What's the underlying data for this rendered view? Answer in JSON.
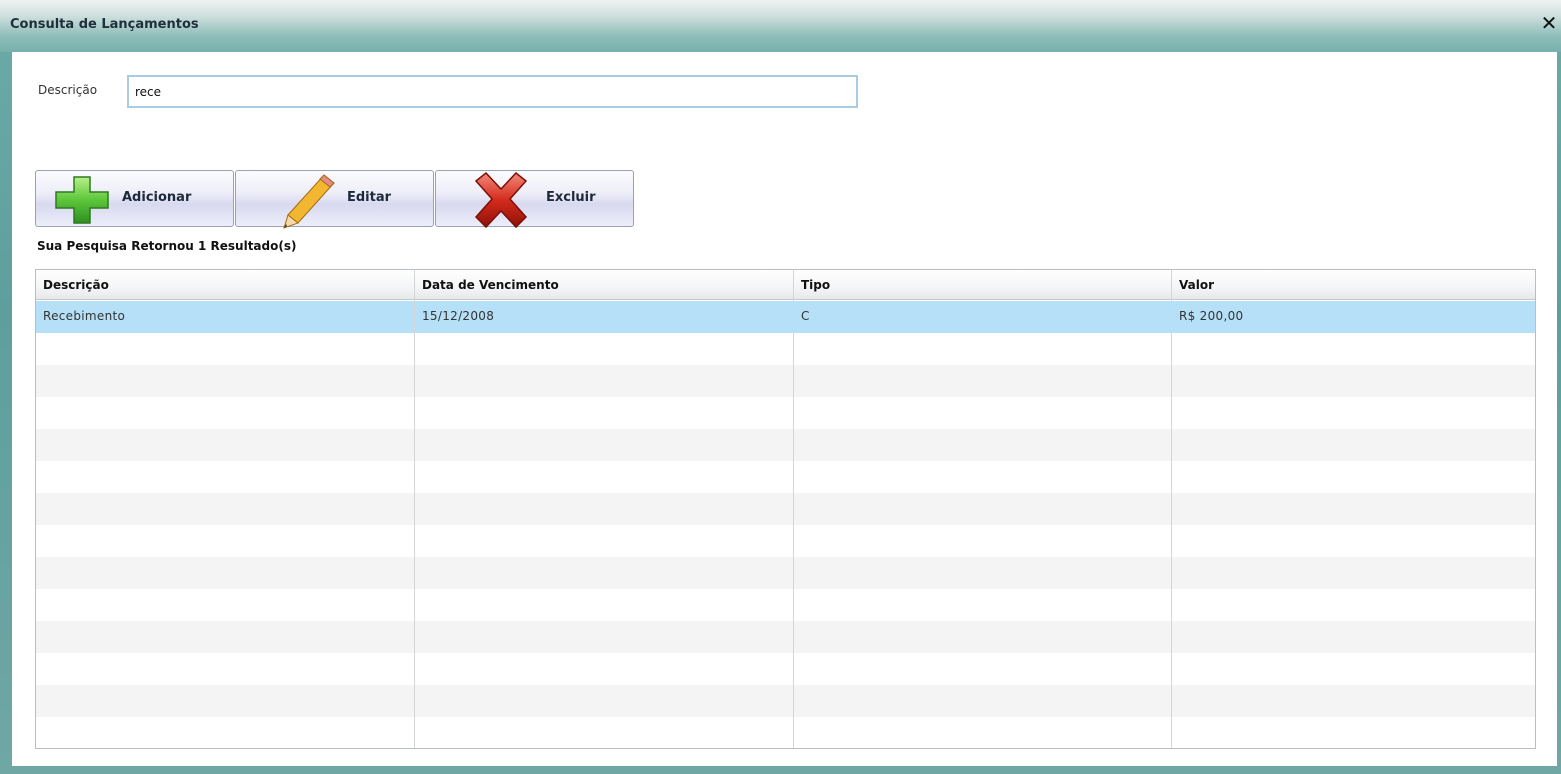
{
  "window": {
    "title": "Consulta de Lançamentos",
    "close_glyph": "✕"
  },
  "search": {
    "label": "Descrição",
    "value": "rece"
  },
  "toolbar": {
    "add_label": "Adicionar",
    "add_icon": "plus-icon",
    "edit_label": "Editar",
    "edit_icon": "pencil-icon",
    "delete_label": "Excluir",
    "delete_icon": "x-icon"
  },
  "result_text": "Sua Pesquisa Retornou 1 Resultado(s)",
  "table": {
    "columns": [
      "Descrição",
      "Data de Vencimento",
      "Tipo",
      "Valor"
    ],
    "rows": [
      [
        "Recebimento",
        "15/12/2008",
        "C",
        "R$ 200,00"
      ]
    ]
  },
  "colors": {
    "selected_row": "#b6e0f7",
    "frame": "#6aa9a6",
    "input_border": "#a8cce3"
  }
}
